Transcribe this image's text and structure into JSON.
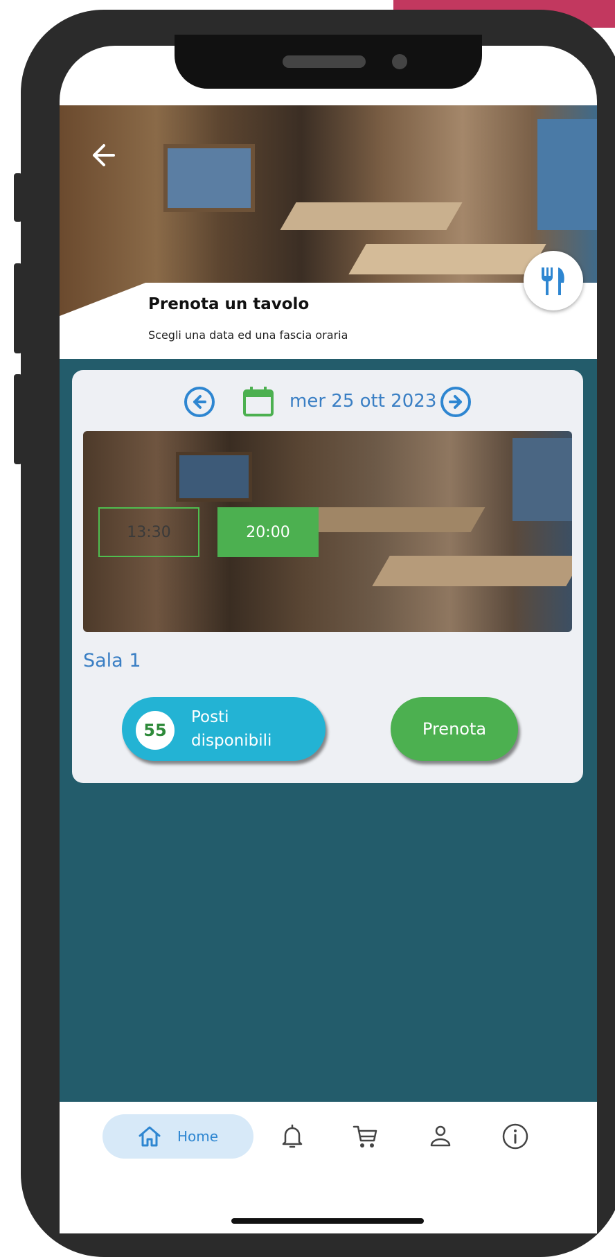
{
  "header": {
    "title": "Prenota un tavolo",
    "subtitle": "Scegli una data ed una fascia oraria"
  },
  "date_selector": {
    "date_label": "mer 25 ott 2023"
  },
  "time_slots": [
    {
      "label": "13:30",
      "selected": false
    },
    {
      "label": "20:00",
      "selected": true
    }
  ],
  "room": {
    "name": "Sala 1",
    "available_seats": "55",
    "available_label_line1": "Posti",
    "available_label_line2": "disponibili",
    "book_label": "Prenota"
  },
  "nav": {
    "home_label": "Home",
    "items": [
      "home-icon",
      "bell-icon",
      "cart-icon",
      "user-icon",
      "info-icon"
    ]
  },
  "colors": {
    "teal_bg": "#235c6b",
    "accent_blue": "#2e86d1",
    "green": "#4cb050",
    "cyan": "#23b3d4",
    "pink": "#c2385f"
  }
}
